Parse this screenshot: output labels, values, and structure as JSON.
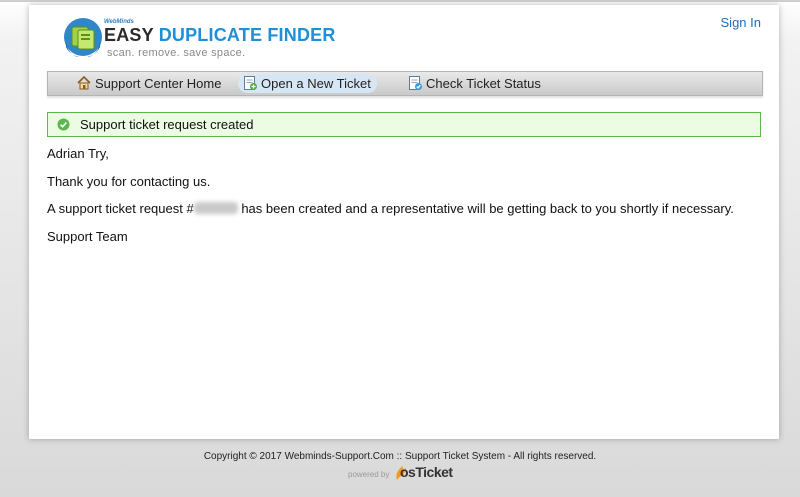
{
  "header": {
    "brand_small": "WebMinds",
    "brand_word1": "EASY",
    "brand_word2": "DUPLICATE FINDER",
    "tagline": "scan. remove. save space.",
    "sign_in": "Sign In"
  },
  "nav": {
    "items": [
      {
        "label": "Support Center Home",
        "icon": "home-icon"
      },
      {
        "label": "Open a New Ticket",
        "icon": "new-ticket-icon",
        "active": true
      },
      {
        "label": "Check Ticket Status",
        "icon": "ticket-status-icon"
      }
    ]
  },
  "notice": {
    "text": "Support ticket request created",
    "icon": "check-circle-icon",
    "colors": {
      "border": "#5cb84a",
      "background": "#ecfbe4"
    }
  },
  "message": {
    "greeting": "Adrian Try,",
    "thanks": "Thank you for contacting us.",
    "line_before": "A support ticket request #",
    "line_after": " has been created and a representative will be getting back to you shortly if necessary.",
    "signature": "Support Team"
  },
  "footer": {
    "copyright": "Copyright © 2017 Webminds-Support.Com :: Support Ticket System - All rights reserved.",
    "powered_by": "powered by",
    "os_ticket": "osTicket"
  },
  "colors": {
    "link": "#1b6eb8",
    "brand_blue": "#1f8fd6"
  }
}
